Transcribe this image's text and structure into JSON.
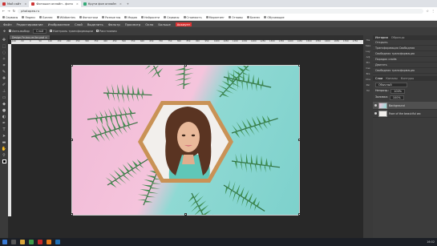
{
  "browser": {
    "tabs": [
      {
        "label": "Мой сайт",
        "active": false
      },
      {
        "label": "Фотошоп онлайн - фото",
        "active": true
      },
      {
        "label": "Крути фон онлайн",
        "active": false
      }
    ],
    "address": "photopea.ru",
    "bookmarks": [
      "Сервисы",
      "Яндекс",
      "Бизнес",
      "Wildberries",
      "Фотостоки",
      "Разные мы",
      "Медиа",
      "Нейросети",
      "Сервисы",
      "Стоимость",
      "Маркетинг",
      "Отзывы",
      "Бизнес",
      "Обучающие"
    ]
  },
  "app": {
    "menu": [
      "Файл",
      "Редактирование",
      "Изображение",
      "Слой",
      "Выделить",
      "Фильтр",
      "Просмотр",
      "Окно",
      "Больше",
      "Аккаунт"
    ],
    "accent_menu_index": 9,
    "options": {
      "autoselect": "Авто-выбор",
      "layer_select": "Слой",
      "show_transform": "Контроль трансформации",
      "distances": "Расстояния"
    },
    "document_tab": "Design-Fe-bou-re-lbn.psd",
    "ruler_ticks": [
      "-100",
      "-50",
      "0",
      "50",
      "100",
      "150",
      "200",
      "250",
      "300",
      "350",
      "400",
      "450",
      "500",
      "550",
      "600",
      "650",
      "700",
      "750",
      "800",
      "850",
      "900",
      "950",
      "1000",
      "1050",
      "1100",
      "1150",
      "1200",
      "1250",
      "1300",
      "1350",
      "1400",
      "1450",
      "1500",
      "1550",
      "1600",
      "1650",
      "1700",
      "1750"
    ],
    "right_icons": [
      "His",
      "Swa",
      "Lay",
      "Adj",
      "Pro",
      "Css",
      "Brs",
      "Cha",
      "Par",
      "Tol"
    ],
    "history": {
      "tabs": [
        "История",
        "Образцы"
      ],
      "items": [
        "Открыть",
        "Трансформация Свободная",
        "Свободная трансформация",
        "Порядок слоёв",
        "Двигать",
        "Свободная трансформация"
      ]
    },
    "layers": {
      "tabs": [
        "Слои",
        "Каналы",
        "Контуры"
      ],
      "blend_mode": "Обычный",
      "opacity_label": "Непрозр.:",
      "opacity": "100%",
      "fill_label": "Заливка:",
      "fill": "100%",
      "items": [
        {
          "name": "Background",
          "selected": true
        },
        {
          "name": "Face of the beautiful wo",
          "selected": false
        }
      ]
    }
  },
  "taskbar": {
    "items": [
      "start",
      "search",
      "explorer",
      "chrome",
      "opera",
      "firefox",
      "photoshop"
    ],
    "clock": "16:02"
  },
  "colors": {
    "accent": "#d33",
    "canvas_pink": "#f5c4dc",
    "canvas_teal": "#8fd9d3",
    "frame": "#c99256"
  }
}
